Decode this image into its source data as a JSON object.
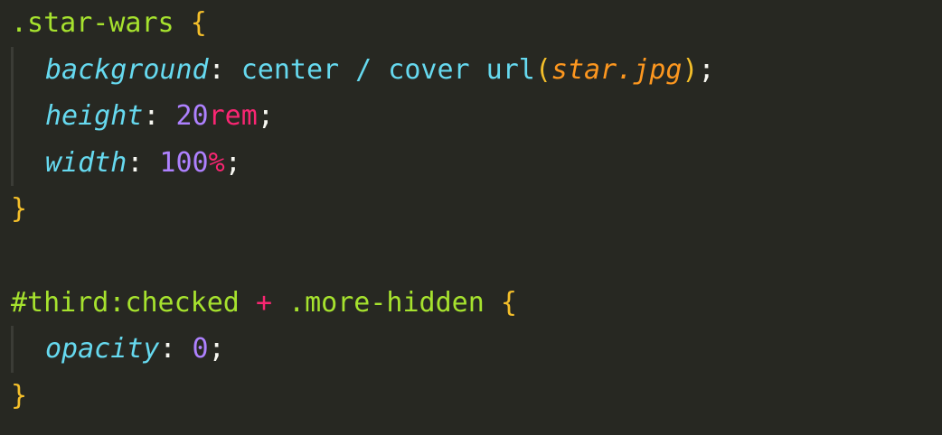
{
  "code": {
    "rule1": {
      "selector": ".star-wars",
      "open_brace": "{",
      "close_brace": "}",
      "decl_background": {
        "property": "background",
        "colon": ":",
        "value_part1": " center / cover url",
        "paren_open": "(",
        "url_arg": "star.jpg",
        "paren_close": ")",
        "semicolon": ";"
      },
      "decl_height": {
        "property": "height",
        "colon": ":",
        "number": " 20",
        "unit": "rem",
        "semicolon": ";"
      },
      "decl_width": {
        "property": "width",
        "colon": ":",
        "number": " 100",
        "unit": "%",
        "semicolon": ";"
      }
    },
    "rule2": {
      "selector_id": "#third:checked",
      "combinator": "+",
      "selector_class": ".more-hidden",
      "open_brace": "{",
      "close_brace": "}",
      "decl_opacity": {
        "property": "opacity",
        "colon": ":",
        "number": " 0",
        "semicolon": ";"
      }
    }
  },
  "colors": {
    "background": "#272822",
    "selector": "#a6e22e",
    "brace": "#f4bf2a",
    "property": "#66d9ef",
    "string": "#fd971f",
    "number": "#ae81ff",
    "unit": "#f92672",
    "plain": "#f8f8f2"
  }
}
